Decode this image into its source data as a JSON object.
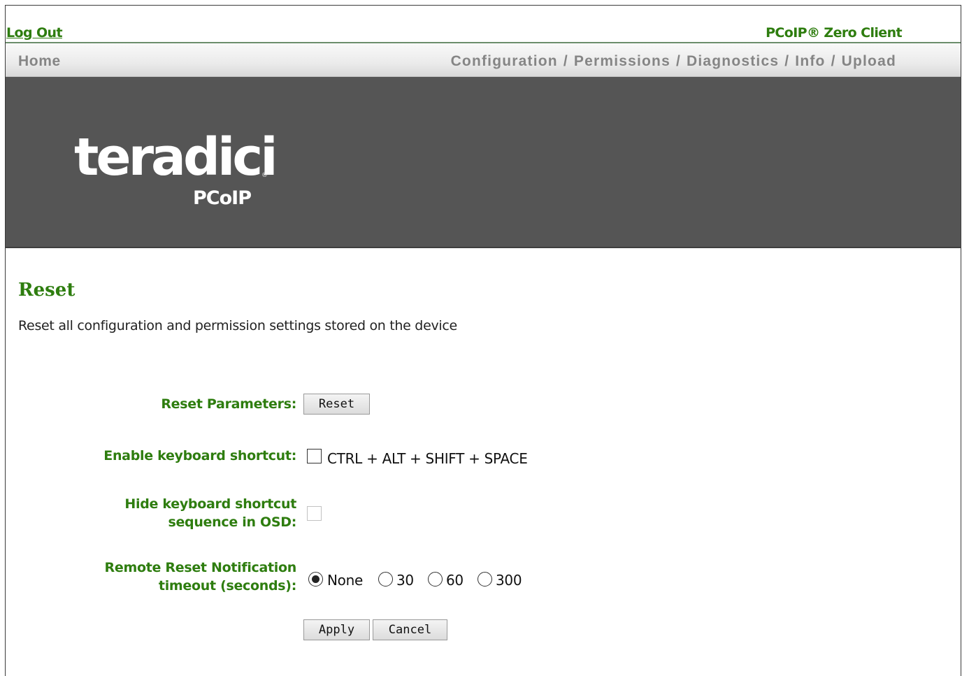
{
  "header": {
    "logout_label": "Log Out",
    "product_label": "PCoIP® Zero Client"
  },
  "nav": {
    "home": "Home",
    "items": [
      "Configuration",
      "Permissions",
      "Diagnostics",
      "Info",
      "Upload"
    ],
    "separator": "/"
  },
  "banner": {
    "logo_text": "teradici",
    "logo_sub": "PCoIP",
    "logo_reg": "®",
    "background": "#555555"
  },
  "page": {
    "title": "Reset",
    "description": "Reset all configuration and permission settings stored on the device"
  },
  "form": {
    "reset_parameters_label": "Reset Parameters:",
    "reset_button": "Reset",
    "enable_shortcut_label": "Enable keyboard shortcut:",
    "enable_shortcut_checked": false,
    "shortcut_text": "CTRL + ALT + SHIFT + SPACE",
    "hide_shortcut_label_line1": "Hide keyboard shortcut",
    "hide_shortcut_label_line2": "sequence in OSD:",
    "hide_shortcut_checked": false,
    "hide_shortcut_disabled": true,
    "timeout_label_line1": "Remote Reset Notification",
    "timeout_label_line2": "timeout (seconds):",
    "timeout_options": [
      "None",
      "30",
      "60",
      "300"
    ],
    "timeout_selected": "None",
    "apply_button": "Apply",
    "cancel_button": "Cancel"
  },
  "colors": {
    "accent_green": "#2e7d0f",
    "nav_text": "#858585"
  }
}
